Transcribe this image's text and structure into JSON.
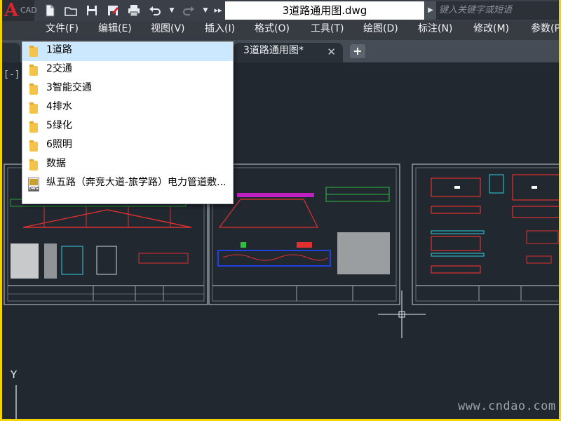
{
  "app": {
    "logo_letter": "A",
    "logo_sub": "CAD",
    "quick_access": [
      "new-icon",
      "open-icon",
      "save-icon",
      "saveas-icon",
      "print-icon",
      "undo-icon",
      "redo-icon",
      "more-icon"
    ],
    "document_title": "3道路通用图.dwg",
    "search_placeholder": "键入关键字或短语"
  },
  "menu": [
    "文件(F)",
    "编辑(E)",
    "视图(V)",
    "插入(I)",
    "格式(O)",
    "工具(T)",
    "绘图(D)",
    "标注(N)",
    "修改(M)",
    "参数(P)"
  ],
  "tabs": {
    "active_label": "3道路通用图*",
    "close_glyph": "✕",
    "add_glyph": "+"
  },
  "viewport_label": "[-][俯",
  "dropdown": {
    "items": [
      {
        "label": "1道路",
        "icon": "folder-icon",
        "selected": true
      },
      {
        "label": "2交通",
        "icon": "folder-icon",
        "selected": false
      },
      {
        "label": "3智能交通",
        "icon": "folder-icon",
        "selected": false
      },
      {
        "label": "4排水",
        "icon": "folder-icon",
        "selected": false
      },
      {
        "label": "5绿化",
        "icon": "folder-icon",
        "selected": false
      },
      {
        "label": "6照明",
        "icon": "folder-icon",
        "selected": false
      },
      {
        "label": "数据",
        "icon": "folder-icon",
        "selected": false
      },
      {
        "label": "纵五路（奔竞大道-旅学路）电力管道敷...",
        "icon": "dwg-file-icon",
        "selected": false
      }
    ]
  },
  "ucs": {
    "y_label": "Y"
  },
  "watermark": "www.cndao.com",
  "colors": {
    "canvas_bg": "#212830",
    "outer_border": "#f2d400",
    "accent_red": "#d8262e",
    "selection": "#cce8ff"
  }
}
